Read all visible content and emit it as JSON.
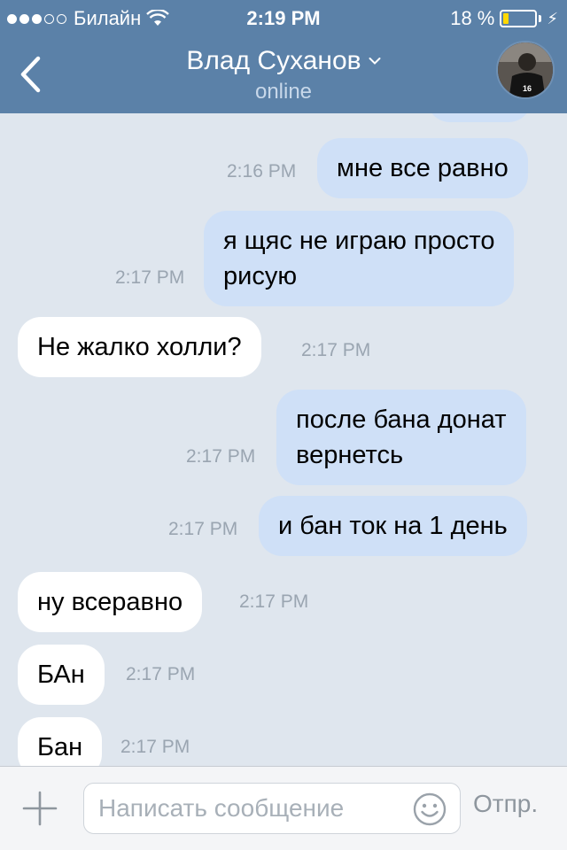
{
  "status": {
    "carrier": "Билайн",
    "time": "2:19 PM",
    "battery_text": "18 %",
    "battery_level": 0.18,
    "signal_bars_filled": 3,
    "signal_bars_total": 5
  },
  "header": {
    "contact_name": "Влад Суханов",
    "status_text": "online",
    "avatar_jersey": "16"
  },
  "colors": {
    "header_bg": "#5b81a8",
    "chat_bg": "#dfe6ee",
    "outgoing_bubble": "#cfe0f7",
    "incoming_bubble": "#ffffff",
    "battery_fill": "#ffd800"
  },
  "messages": [
    {
      "direction": "out",
      "lines": [
        "мне все равно"
      ],
      "time": "2:16 PM"
    },
    {
      "direction": "out",
      "lines": [
        "я щяс не играю просто",
        "рисую"
      ],
      "time": "2:17 PM"
    },
    {
      "direction": "in",
      "lines": [
        "Не жалко холли?"
      ],
      "time": "2:17 PM"
    },
    {
      "direction": "out",
      "lines": [
        "после бана донат",
        "вернетсь"
      ],
      "time": "2:17 PM"
    },
    {
      "direction": "out",
      "lines": [
        "и бан ток на 1 день"
      ],
      "time": "2:17 PM"
    },
    {
      "direction": "in",
      "lines": [
        "ну всеравно"
      ],
      "time": "2:17 PM"
    },
    {
      "direction": "in",
      "lines": [
        "БАн"
      ],
      "time": "2:17 PM"
    },
    {
      "direction": "in",
      "lines": [
        "Бан"
      ],
      "time": "2:17 PM"
    }
  ],
  "composer": {
    "placeholder": "Написать сообщение",
    "value": "",
    "send_label": "Отпр."
  },
  "icons": {
    "back": "chevron-left-icon",
    "dropdown": "chevron-down-icon",
    "add": "plus-icon",
    "emoji": "smile-icon",
    "wifi": "wifi-icon",
    "battery": "battery-icon",
    "charging": "bolt-icon"
  }
}
